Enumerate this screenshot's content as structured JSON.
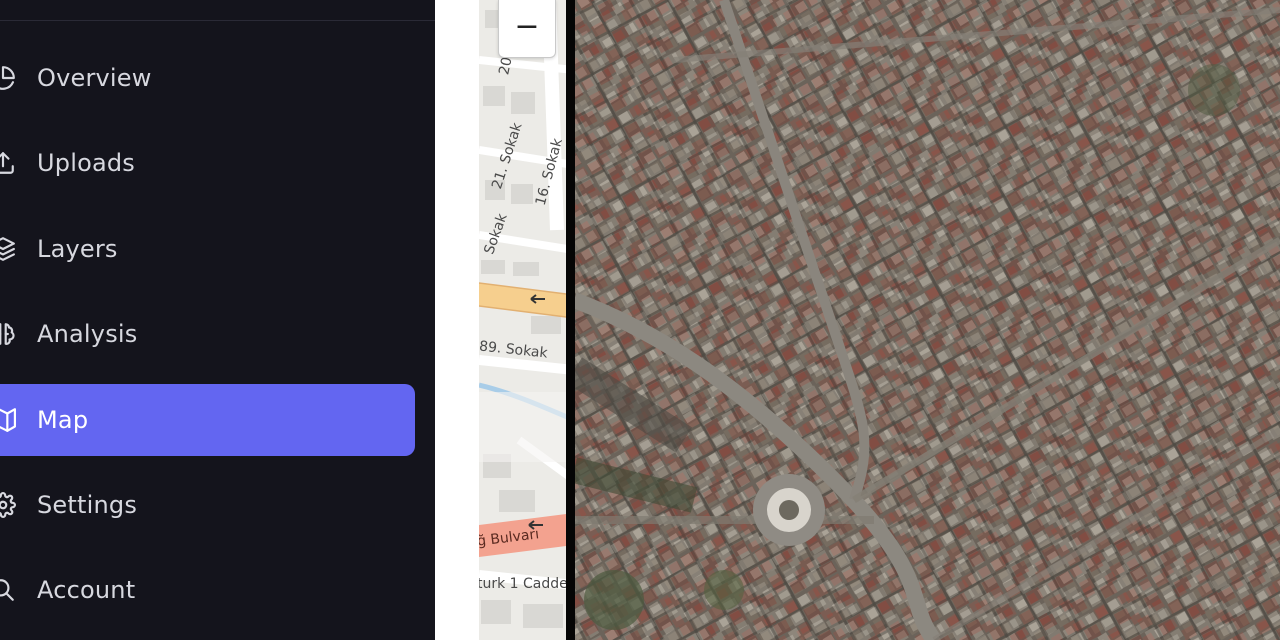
{
  "sidebar": {
    "items": [
      {
        "label": "Overview",
        "icon": "pie-chart-icon",
        "active": false
      },
      {
        "label": "Uploads",
        "icon": "upload-icon",
        "active": false
      },
      {
        "label": "Layers",
        "icon": "layers-icon",
        "active": false
      },
      {
        "label": "Analysis",
        "icon": "brain-icon",
        "active": false
      },
      {
        "label": "Map",
        "icon": "map-icon",
        "active": true
      },
      {
        "label": "Settings",
        "icon": "gear-icon",
        "active": false
      },
      {
        "label": "Account",
        "icon": "user-search-icon",
        "active": false
      }
    ],
    "colors": {
      "background": "#14141c",
      "active": "#6366f1",
      "text": "#d7d8df"
    }
  },
  "map": {
    "zoom_out_label": "−",
    "street_labels": [
      "20",
      "21. Sokak",
      "16. Sokak",
      "Sokak",
      "89. Sokak",
      "ğ Bulvarı",
      "turk 1 Cadde"
    ]
  }
}
